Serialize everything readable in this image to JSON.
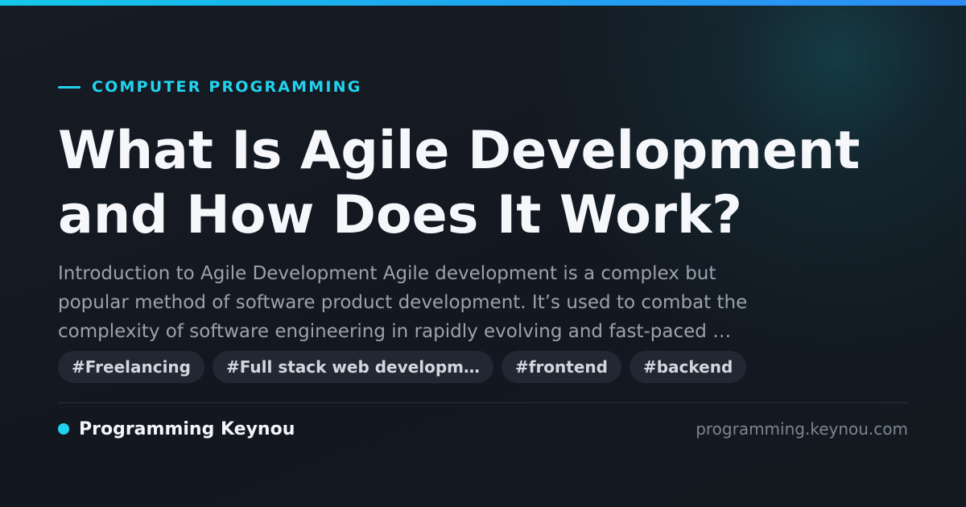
{
  "colors": {
    "accent": "#22d3ee",
    "background": "#141922",
    "title": "#f5f7fa",
    "excerpt": "#9aa2ae",
    "tag_background": "#212733",
    "tag_text": "#d3d8df",
    "domain_text": "#7d8591"
  },
  "category": "COMPUTER PROGRAMMING",
  "title": {
    "line1": "What Is Agile Development",
    "line2": "and How Does It Work?"
  },
  "excerpt": {
    "line1": "Introduction to Agile Development Agile development is a complex but",
    "line2": "popular method of software product development. It’s used to combat the",
    "line3": "complexity of software engineering in rapidly evolving and fast-paced …"
  },
  "tags": [
    "#Freelancing",
    "#Full stack web developm…",
    "#frontend",
    "#backend"
  ],
  "footer": {
    "brand_name": "Programming Keynou",
    "domain": "programming.keynou.com"
  }
}
